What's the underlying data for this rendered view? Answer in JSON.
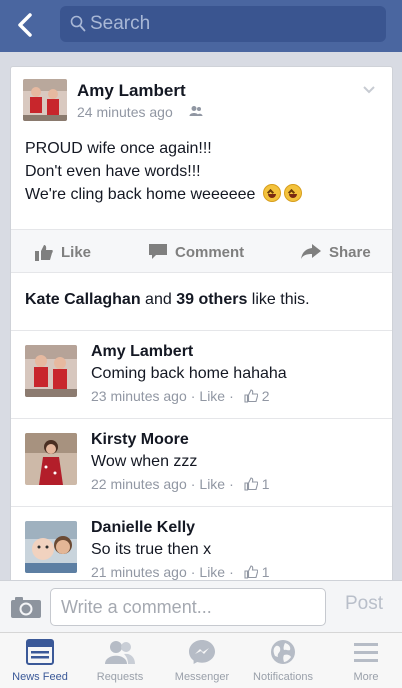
{
  "nav": {
    "search_placeholder": "Search"
  },
  "post": {
    "author": "Amy Lambert",
    "time": "24 minutes ago",
    "lines": [
      "PROUD wife once again!!!",
      "Don't even have words!!!",
      "We're cling back home weeeeee"
    ]
  },
  "actions": {
    "like": "Like",
    "comment": "Comment",
    "share": "Share"
  },
  "likes": {
    "names": "Kate Callaghan",
    "and": "and",
    "others": "39 others",
    "suffix": "like this."
  },
  "comments": [
    {
      "name": "Amy Lambert",
      "text": "Coming back home hahaha",
      "time": "23 minutes ago",
      "like": "Like",
      "likes": "2"
    },
    {
      "name": "Kirsty Moore",
      "text": "Wow when zzz",
      "time": "22 minutes ago",
      "like": "Like",
      "likes": "1"
    },
    {
      "name": "Danielle Kelly",
      "text": "So its true then x",
      "time": "21 minutes ago",
      "like": "Like",
      "likes": "1"
    }
  ],
  "composer": {
    "placeholder": "Write a comment...",
    "post": "Post"
  },
  "tabs": [
    "News Feed",
    "Requests",
    "Messenger",
    "Notifications",
    "More"
  ],
  "colors": {
    "brand": "#4a66a0",
    "link": "#3b5998"
  },
  "icons": [
    "chevron-left-icon",
    "search-icon",
    "friends-icon",
    "chevron-down-icon",
    "like-icon",
    "comment-icon",
    "share-icon",
    "thumbs-up-icon",
    "camera-icon",
    "news-feed-icon",
    "requests-icon",
    "messenger-icon",
    "notifications-icon",
    "more-icon"
  ]
}
